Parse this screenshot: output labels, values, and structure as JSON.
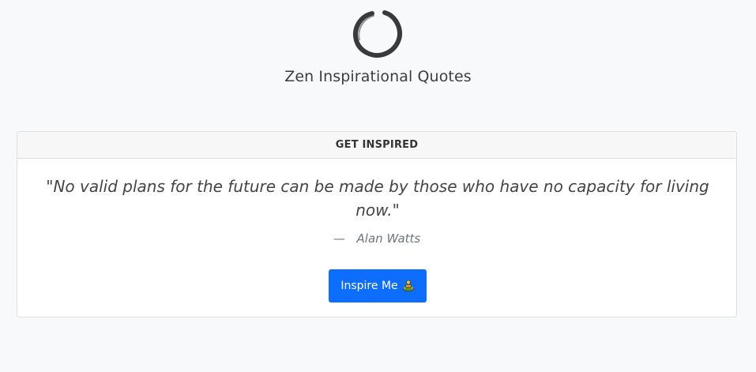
{
  "header": {
    "logo_icon": "enso-circle-icon",
    "title": "Zen Inspirational Quotes"
  },
  "card": {
    "heading": "GET INSPIRED",
    "quote_text": "\"No valid plans for the future can be made by those who have no capacity for living now.\"",
    "author_dash": "—",
    "author": "Alan Watts",
    "button_label": "Inspire Me",
    "button_icon": "meditating-person-icon"
  },
  "colors": {
    "page_background": "#f8f9fa",
    "primary_button": "#0d6efd",
    "card_header_background": "#f7f7f7"
  }
}
